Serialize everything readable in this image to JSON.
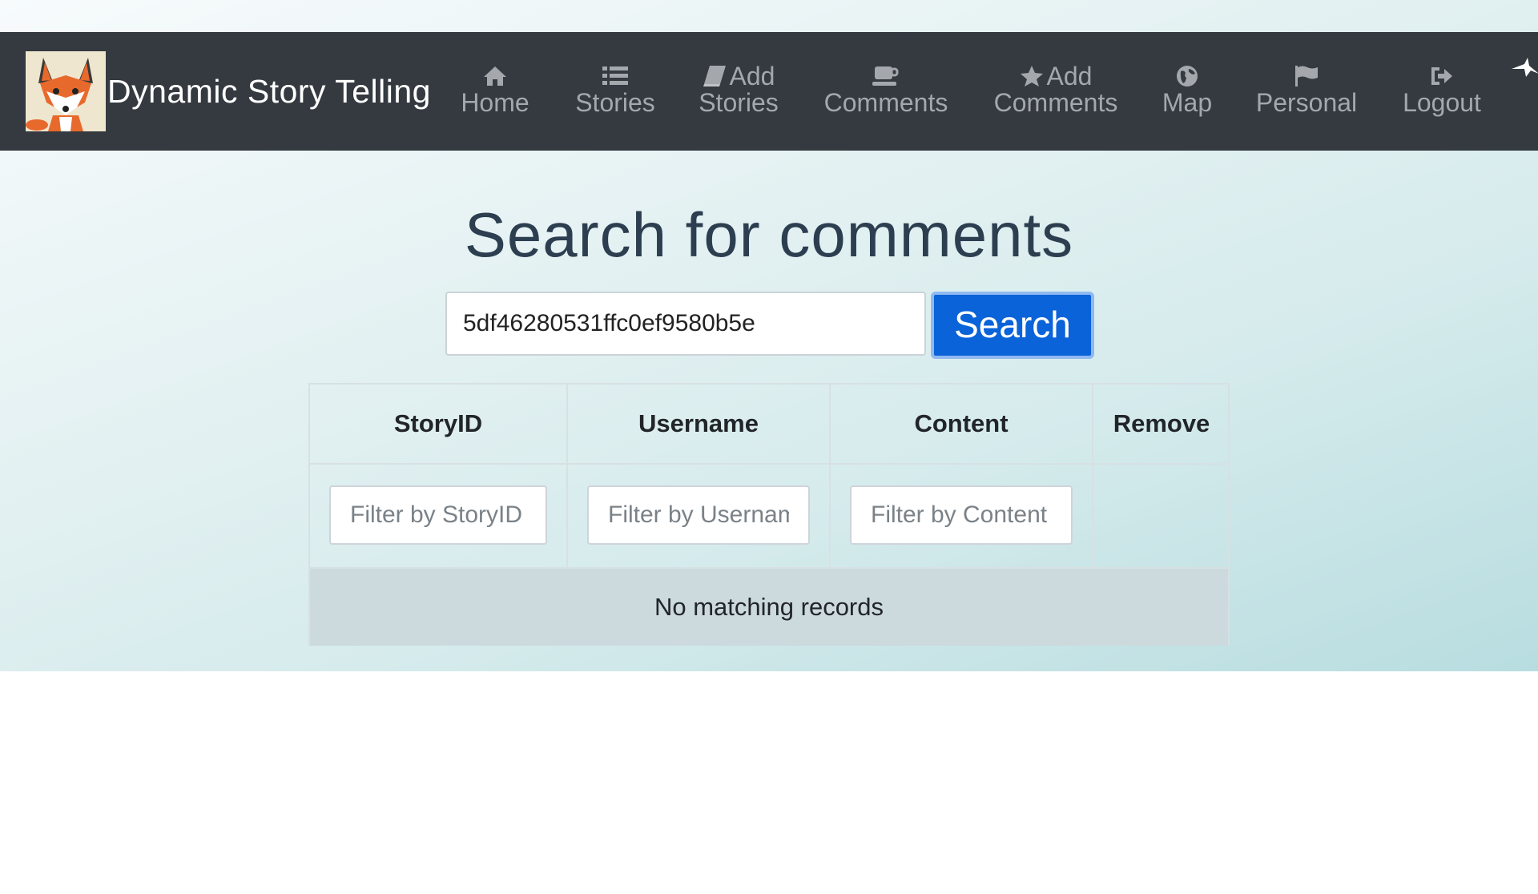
{
  "app": {
    "brand_title": "Dynamic Story Telling"
  },
  "nav": {
    "items": [
      {
        "line1": "",
        "line2": "Home",
        "icon": "home-icon"
      },
      {
        "line1": "",
        "line2": "Stories",
        "icon": "list-icon"
      },
      {
        "line1": "Add",
        "line2": "Stories",
        "icon": "book-icon"
      },
      {
        "line1": "",
        "line2": "Comments",
        "icon": "cup-icon"
      },
      {
        "line1": "Add",
        "line2": "Comments",
        "icon": "star-icon"
      },
      {
        "line1": "",
        "line2": "Map",
        "icon": "globe-icon"
      },
      {
        "line1": "",
        "line2": "Personal",
        "icon": "flag-icon"
      },
      {
        "line1": "",
        "line2": "Logout",
        "icon": "logout-icon"
      }
    ]
  },
  "main": {
    "title": "Search for comments",
    "search": {
      "value": "5df46280531ffc0ef9580b5e",
      "button_label": "Search"
    },
    "table": {
      "columns": [
        "StoryID",
        "Username",
        "Content",
        "Remove"
      ],
      "filters": [
        {
          "placeholder": "Filter by StoryID"
        },
        {
          "placeholder": "Filter by Username"
        },
        {
          "placeholder": "Filter by Content"
        }
      ],
      "empty_message": "No matching records"
    }
  },
  "colors": {
    "navbar_bg": "#343a40",
    "nav_text": "#a4a8ac",
    "primary_button": "#0a63d8",
    "title_text": "#2c3e50",
    "empty_row_bg": "#ccdadd"
  }
}
